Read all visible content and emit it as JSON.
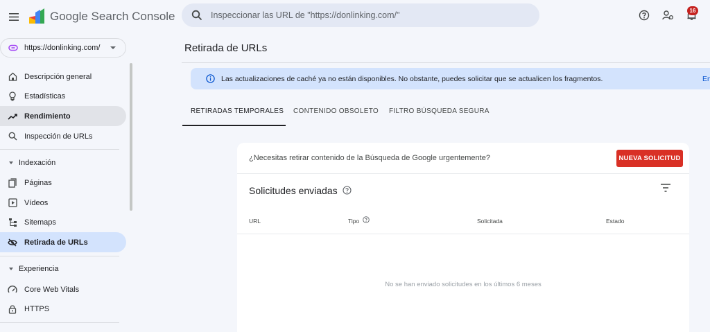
{
  "header": {
    "menu_icon": "menu-icon",
    "brand": "Google Search Console",
    "search_placeholder": "Inspeccionar las URL de \"https://donlinking.com/\"",
    "notifications_count": "16"
  },
  "property": {
    "label": "https://donlinking.com/"
  },
  "sidebar": {
    "items": [
      {
        "label": "Descripción general",
        "icon": "home-icon"
      },
      {
        "label": "Estadísticas",
        "icon": "lightbulb-icon"
      },
      {
        "label": "Rendimiento",
        "icon": "trending-up-icon",
        "state": "hover"
      },
      {
        "label": "Inspección de URLs",
        "icon": "search-icon"
      }
    ],
    "sections": [
      {
        "title": "Indexación",
        "items": [
          {
            "label": "Páginas",
            "icon": "pages-icon"
          },
          {
            "label": "Vídeos",
            "icon": "video-icon"
          },
          {
            "label": "Sitemaps",
            "icon": "sitemap-icon"
          },
          {
            "label": "Retirada de URLs",
            "icon": "eye-off-icon",
            "state": "selected"
          }
        ]
      },
      {
        "title": "Experiencia",
        "items": [
          {
            "label": "Core Web Vitals",
            "icon": "gauge-icon"
          },
          {
            "label": "HTTPS",
            "icon": "lock-icon"
          }
        ]
      }
    ]
  },
  "main": {
    "title": "Retirada de URLs",
    "banner": {
      "text": "Las actualizaciones de caché ya no están disponibles. No obstante, puedes solicitar que se actualicen los fragmentos.",
      "link": "En"
    },
    "tabs": [
      {
        "label": "RETIRADAS TEMPORALES",
        "active": true
      },
      {
        "label": "CONTENIDO OBSOLETO"
      },
      {
        "label": "FILTRO BÚSQUEDA SEGURA"
      }
    ],
    "card": {
      "question": "¿Necesitas retirar contenido de la Búsqueda de Google urgentemente?",
      "new_button": "NUEVA SOLICITUD",
      "section_title": "Solicitudes enviadas",
      "columns": [
        "URL",
        "Tipo",
        "Solicitada",
        "Estado"
      ],
      "empty_message": "No se han enviado solicitudes en los últimos 6 meses"
    }
  },
  "colors": {
    "background": "#f4f6fb",
    "search_bg": "#e3e8f4",
    "selected_bg": "#d3e3fd",
    "hover_bg": "#e1e3e8",
    "danger": "#d93025"
  }
}
